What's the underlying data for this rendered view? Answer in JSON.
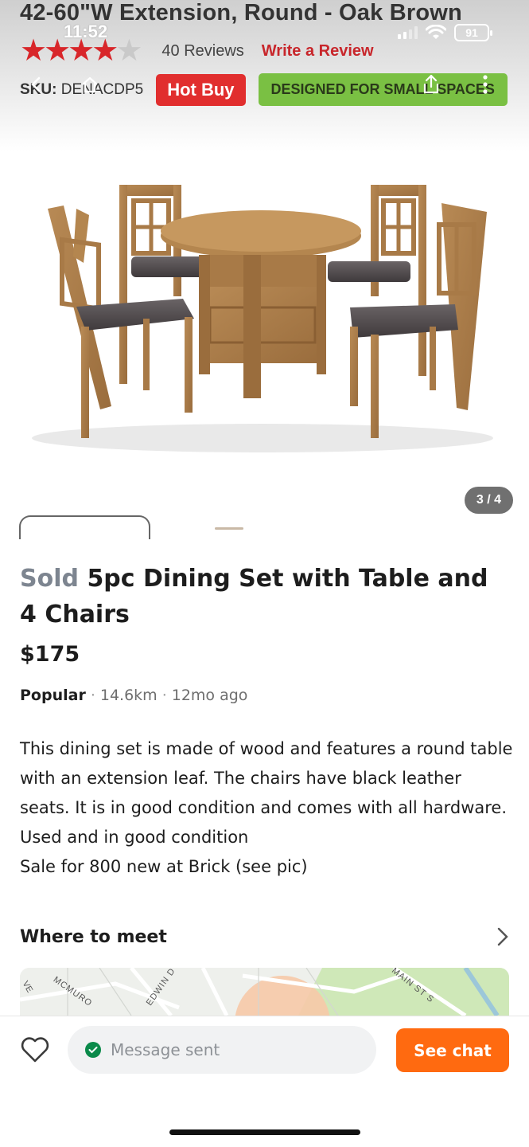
{
  "status_bar": {
    "time": "11:52",
    "battery": "91"
  },
  "banner": {
    "product_title": "42-60\"W Extension, Round - Oak Brown",
    "rating_stars": 4,
    "rating_max": 5,
    "reviews": "40 Reviews",
    "write_review": "Write a Review",
    "sku_label": "SKU:",
    "sku_value": "DENACDP5",
    "hot_buy": "Hot Buy",
    "designed_badge": "DESIGNED FOR SMALL SPACES"
  },
  "gallery": {
    "pager": "3 / 4"
  },
  "listing": {
    "sold_label": "Sold",
    "title": "5pc Dining Set with Table and 4 Chairs",
    "price": "$175",
    "popular": "Popular",
    "distance": "14.6km",
    "posted": "12mo ago",
    "description": "This dining set is made of wood and features a round table with an extension leaf. The chairs have black leather seats. It is in good condition and comes with all hardware.  Used and in good condition\nSale for 800 new at Brick (see pic)",
    "where_to_meet": "Where to meet"
  },
  "map_labels": {
    "street_1": "MCMURO",
    "street_2": "EDWIN D",
    "street_3": "MAIN ST S",
    "street_4": "VE"
  },
  "bottom_bar": {
    "message_status": "Message sent",
    "see_chat": "See chat"
  },
  "colors": {
    "accent_orange": "#ff6a10",
    "sold_grey": "#7d8590",
    "hot_buy_red": "#e12e2e",
    "designed_green": "#7ac043",
    "success_green": "#0b8a4a"
  },
  "icons": {
    "favorite": "heart-icon",
    "sent": "check-circle-icon",
    "back": "back-arrow-icon",
    "share": "share-icon",
    "more": "more-vertical-icon",
    "chevron": "chevron-right-icon"
  }
}
